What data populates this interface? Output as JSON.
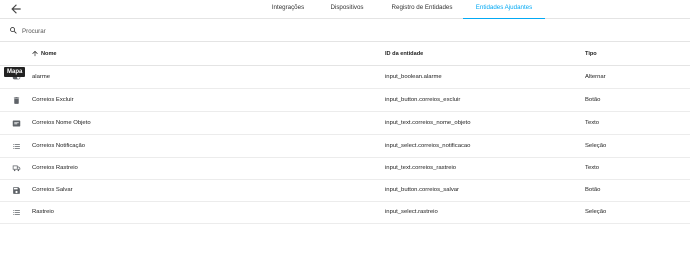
{
  "tabs": [
    {
      "label": "Integrações",
      "active": false
    },
    {
      "label": "Dispositivos",
      "active": false
    },
    {
      "label": "Registro de Entidades",
      "active": false
    },
    {
      "label": "Entidades Ajudantes",
      "active": true
    }
  ],
  "search": {
    "placeholder": "Procurar",
    "value": ""
  },
  "table": {
    "headers": {
      "name": "Nome",
      "entity_id": "ID da entidade",
      "type": "Tipo"
    },
    "rows": [
      {
        "icon": "toggle-icon",
        "name": "alarme",
        "entity_id": "input_boolean.alarme",
        "type": "Alternar"
      },
      {
        "icon": "trash-icon",
        "name": "Correios Excluir",
        "entity_id": "input_button.correios_excluir",
        "type": "Botão"
      },
      {
        "icon": "text-box-icon",
        "name": "Correios Nome Objeto",
        "entity_id": "input_text.correios_nome_objeto",
        "type": "Texto"
      },
      {
        "icon": "list-icon",
        "name": "Correios Notificação",
        "entity_id": "input_select.correios_notificacao",
        "type": "Seleção"
      },
      {
        "icon": "truck-icon",
        "name": "Correios Rastreio",
        "entity_id": "input_text.correios_rastreio",
        "type": "Texto"
      },
      {
        "icon": "floppy-icon",
        "name": "Correios Salvar",
        "entity_id": "input_button.correios_salvar",
        "type": "Botão"
      },
      {
        "icon": "list-icon",
        "name": "Rastreio",
        "entity_id": "input_select.rastreio",
        "type": "Seleção"
      }
    ]
  },
  "tooltip": {
    "text": "Mapa"
  },
  "colors": {
    "accent": "#03a9f4",
    "icon": "#5f6368",
    "border": "#e4e4e4"
  }
}
